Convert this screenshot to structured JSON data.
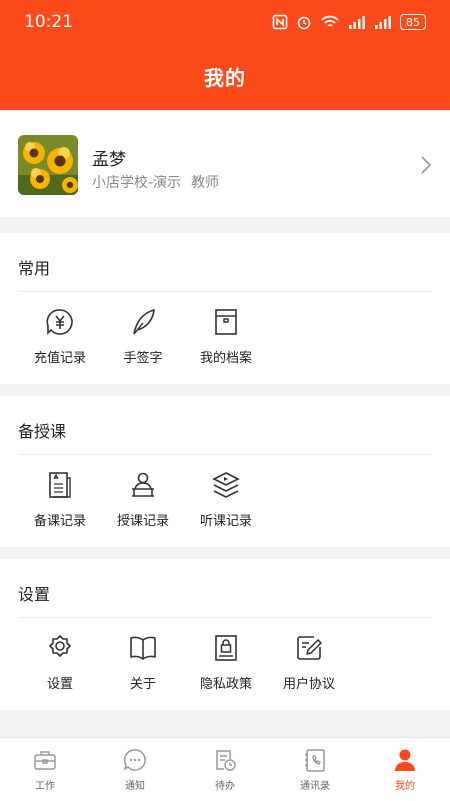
{
  "status": {
    "time": "10:21",
    "battery": "85"
  },
  "header": {
    "title": "我的"
  },
  "profile": {
    "name": "孟梦",
    "school": "小店学校-演示",
    "role": "教师"
  },
  "sections": [
    {
      "title": "常用",
      "items": [
        {
          "label": "充值记录",
          "icon": "yuan-icon"
        },
        {
          "label": "手签字",
          "icon": "feather-icon"
        },
        {
          "label": "我的档案",
          "icon": "archive-icon"
        }
      ]
    },
    {
      "title": "备授课",
      "items": [
        {
          "label": "备课记录",
          "icon": "lesson-doc-icon"
        },
        {
          "label": "授课记录",
          "icon": "teacher-icon"
        },
        {
          "label": "听课记录",
          "icon": "layers-play-icon"
        }
      ]
    },
    {
      "title": "设置",
      "items": [
        {
          "label": "设置",
          "icon": "gear-icon"
        },
        {
          "label": "关于",
          "icon": "book-icon"
        },
        {
          "label": "隐私政策",
          "icon": "lock-doc-icon"
        },
        {
          "label": "用户协议",
          "icon": "edit-doc-icon"
        }
      ]
    }
  ],
  "tabs": [
    {
      "label": "工作",
      "icon": "briefcase-icon"
    },
    {
      "label": "通知",
      "icon": "chat-icon"
    },
    {
      "label": "待办",
      "icon": "todo-icon"
    },
    {
      "label": "通讯录",
      "icon": "contacts-icon"
    },
    {
      "label": "我的",
      "icon": "user-icon",
      "active": true
    }
  ],
  "colors": {
    "accent": "#fc4a1a",
    "muted": "#888888"
  }
}
